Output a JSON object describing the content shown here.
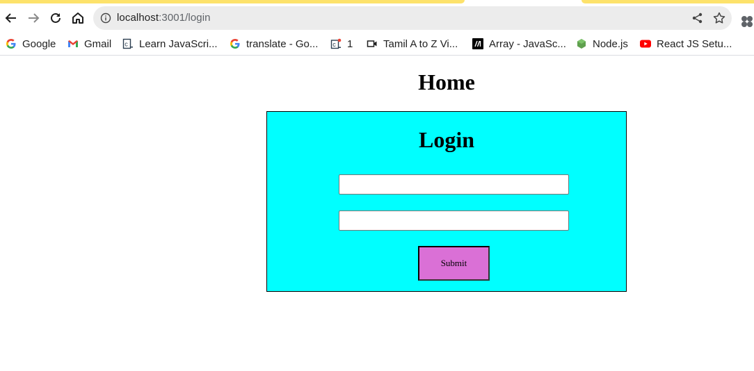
{
  "browser": {
    "address": {
      "host": "localhost",
      "rest": ":3001/login"
    },
    "bookmarks": [
      {
        "label": "Google",
        "icon": "google-g-icon"
      },
      {
        "label": "Gmail",
        "icon": "gmail-icon"
      },
      {
        "label": "Learn JavaScri...",
        "icon": "site-c-icon"
      },
      {
        "label": "translate - Go...",
        "icon": "google-g-icon"
      },
      {
        "label": "1",
        "icon": "site-c-badge-icon"
      },
      {
        "label": "Tamil A to Z Vi...",
        "icon": "video-icon"
      },
      {
        "label": "Array - JavaSc...",
        "icon": "mdn-icon"
      },
      {
        "label": "Node.js",
        "icon": "nodejs-icon"
      },
      {
        "label": "React JS Setu...",
        "icon": "youtube-icon"
      }
    ]
  },
  "page": {
    "home_title": "Home",
    "login_title": "Login",
    "username_value": "",
    "password_value": "",
    "submit_label": "Submit"
  },
  "colors": {
    "tab_accent": "#fde26b",
    "login_box_bg": "#00ffff",
    "submit_bg": "#da70d6"
  }
}
